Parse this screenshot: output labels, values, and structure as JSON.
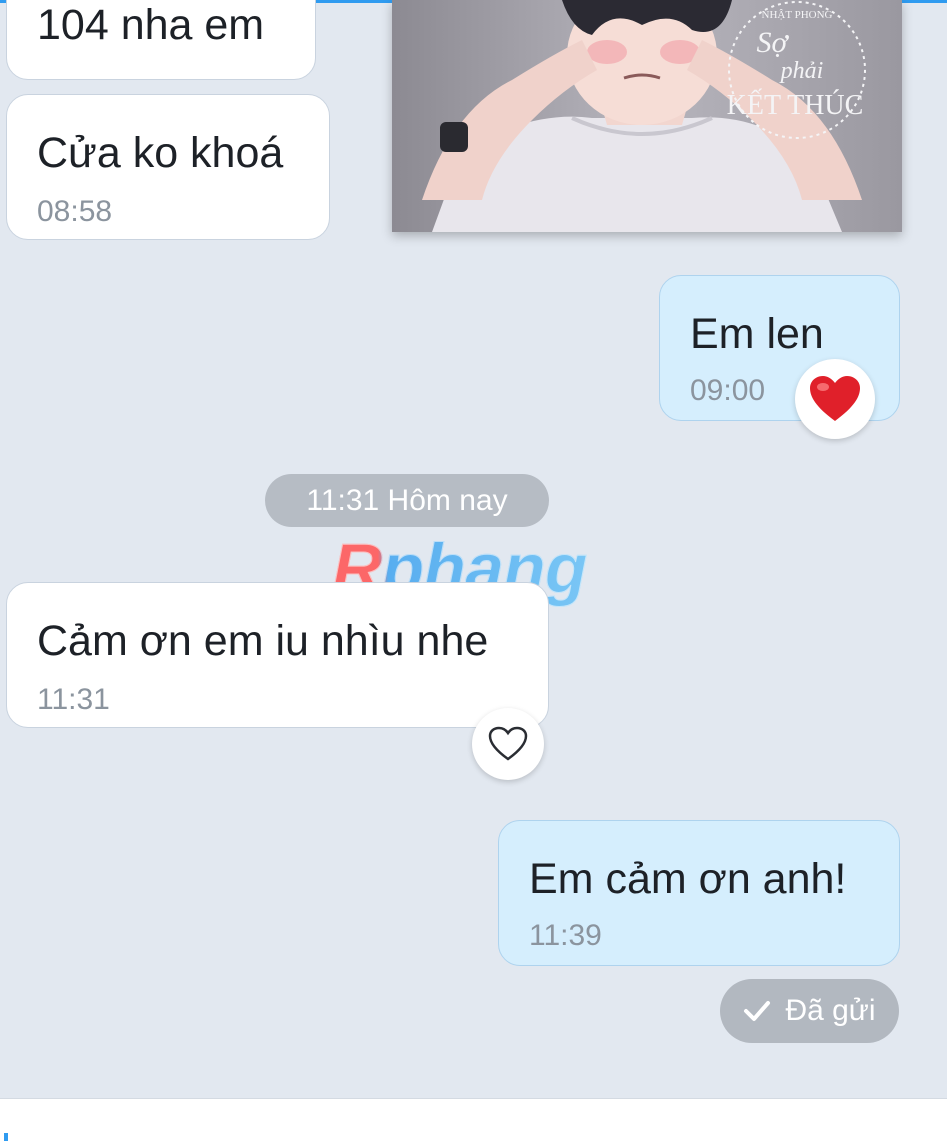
{
  "messages": [
    {
      "id": "m1",
      "direction": "incoming",
      "text": "104 nha em",
      "time": ""
    },
    {
      "id": "m2",
      "direction": "incoming",
      "text": "Cửa ko khoá",
      "time": "08:58"
    },
    {
      "id": "m3",
      "direction": "outgoing",
      "text": "Em len",
      "time": "09:00",
      "reaction": "red-heart"
    },
    {
      "id": "m4",
      "direction": "incoming",
      "text": "Cảm ơn em iu nhìu nhe",
      "time": "11:31",
      "reaction": "heart-outline"
    },
    {
      "id": "m5",
      "direction": "outgoing",
      "text": "Em cảm ơn anh!",
      "time": "11:39"
    }
  ],
  "image_message": {
    "brand_line": "NHẬT PHONG",
    "title_line1": "Sợ",
    "title_line2": "phải",
    "title_line3": "KẾT THÚC"
  },
  "date_separator": "11:31 Hôm nay",
  "watermark": "Rphang",
  "status": {
    "label": "Đã gửi",
    "icon": "check-icon"
  },
  "colors": {
    "accent": "#2f9bf0",
    "heart": "#e0202a",
    "background": "#e2e8f0",
    "outgoing_bubble": "#d5eefd"
  }
}
